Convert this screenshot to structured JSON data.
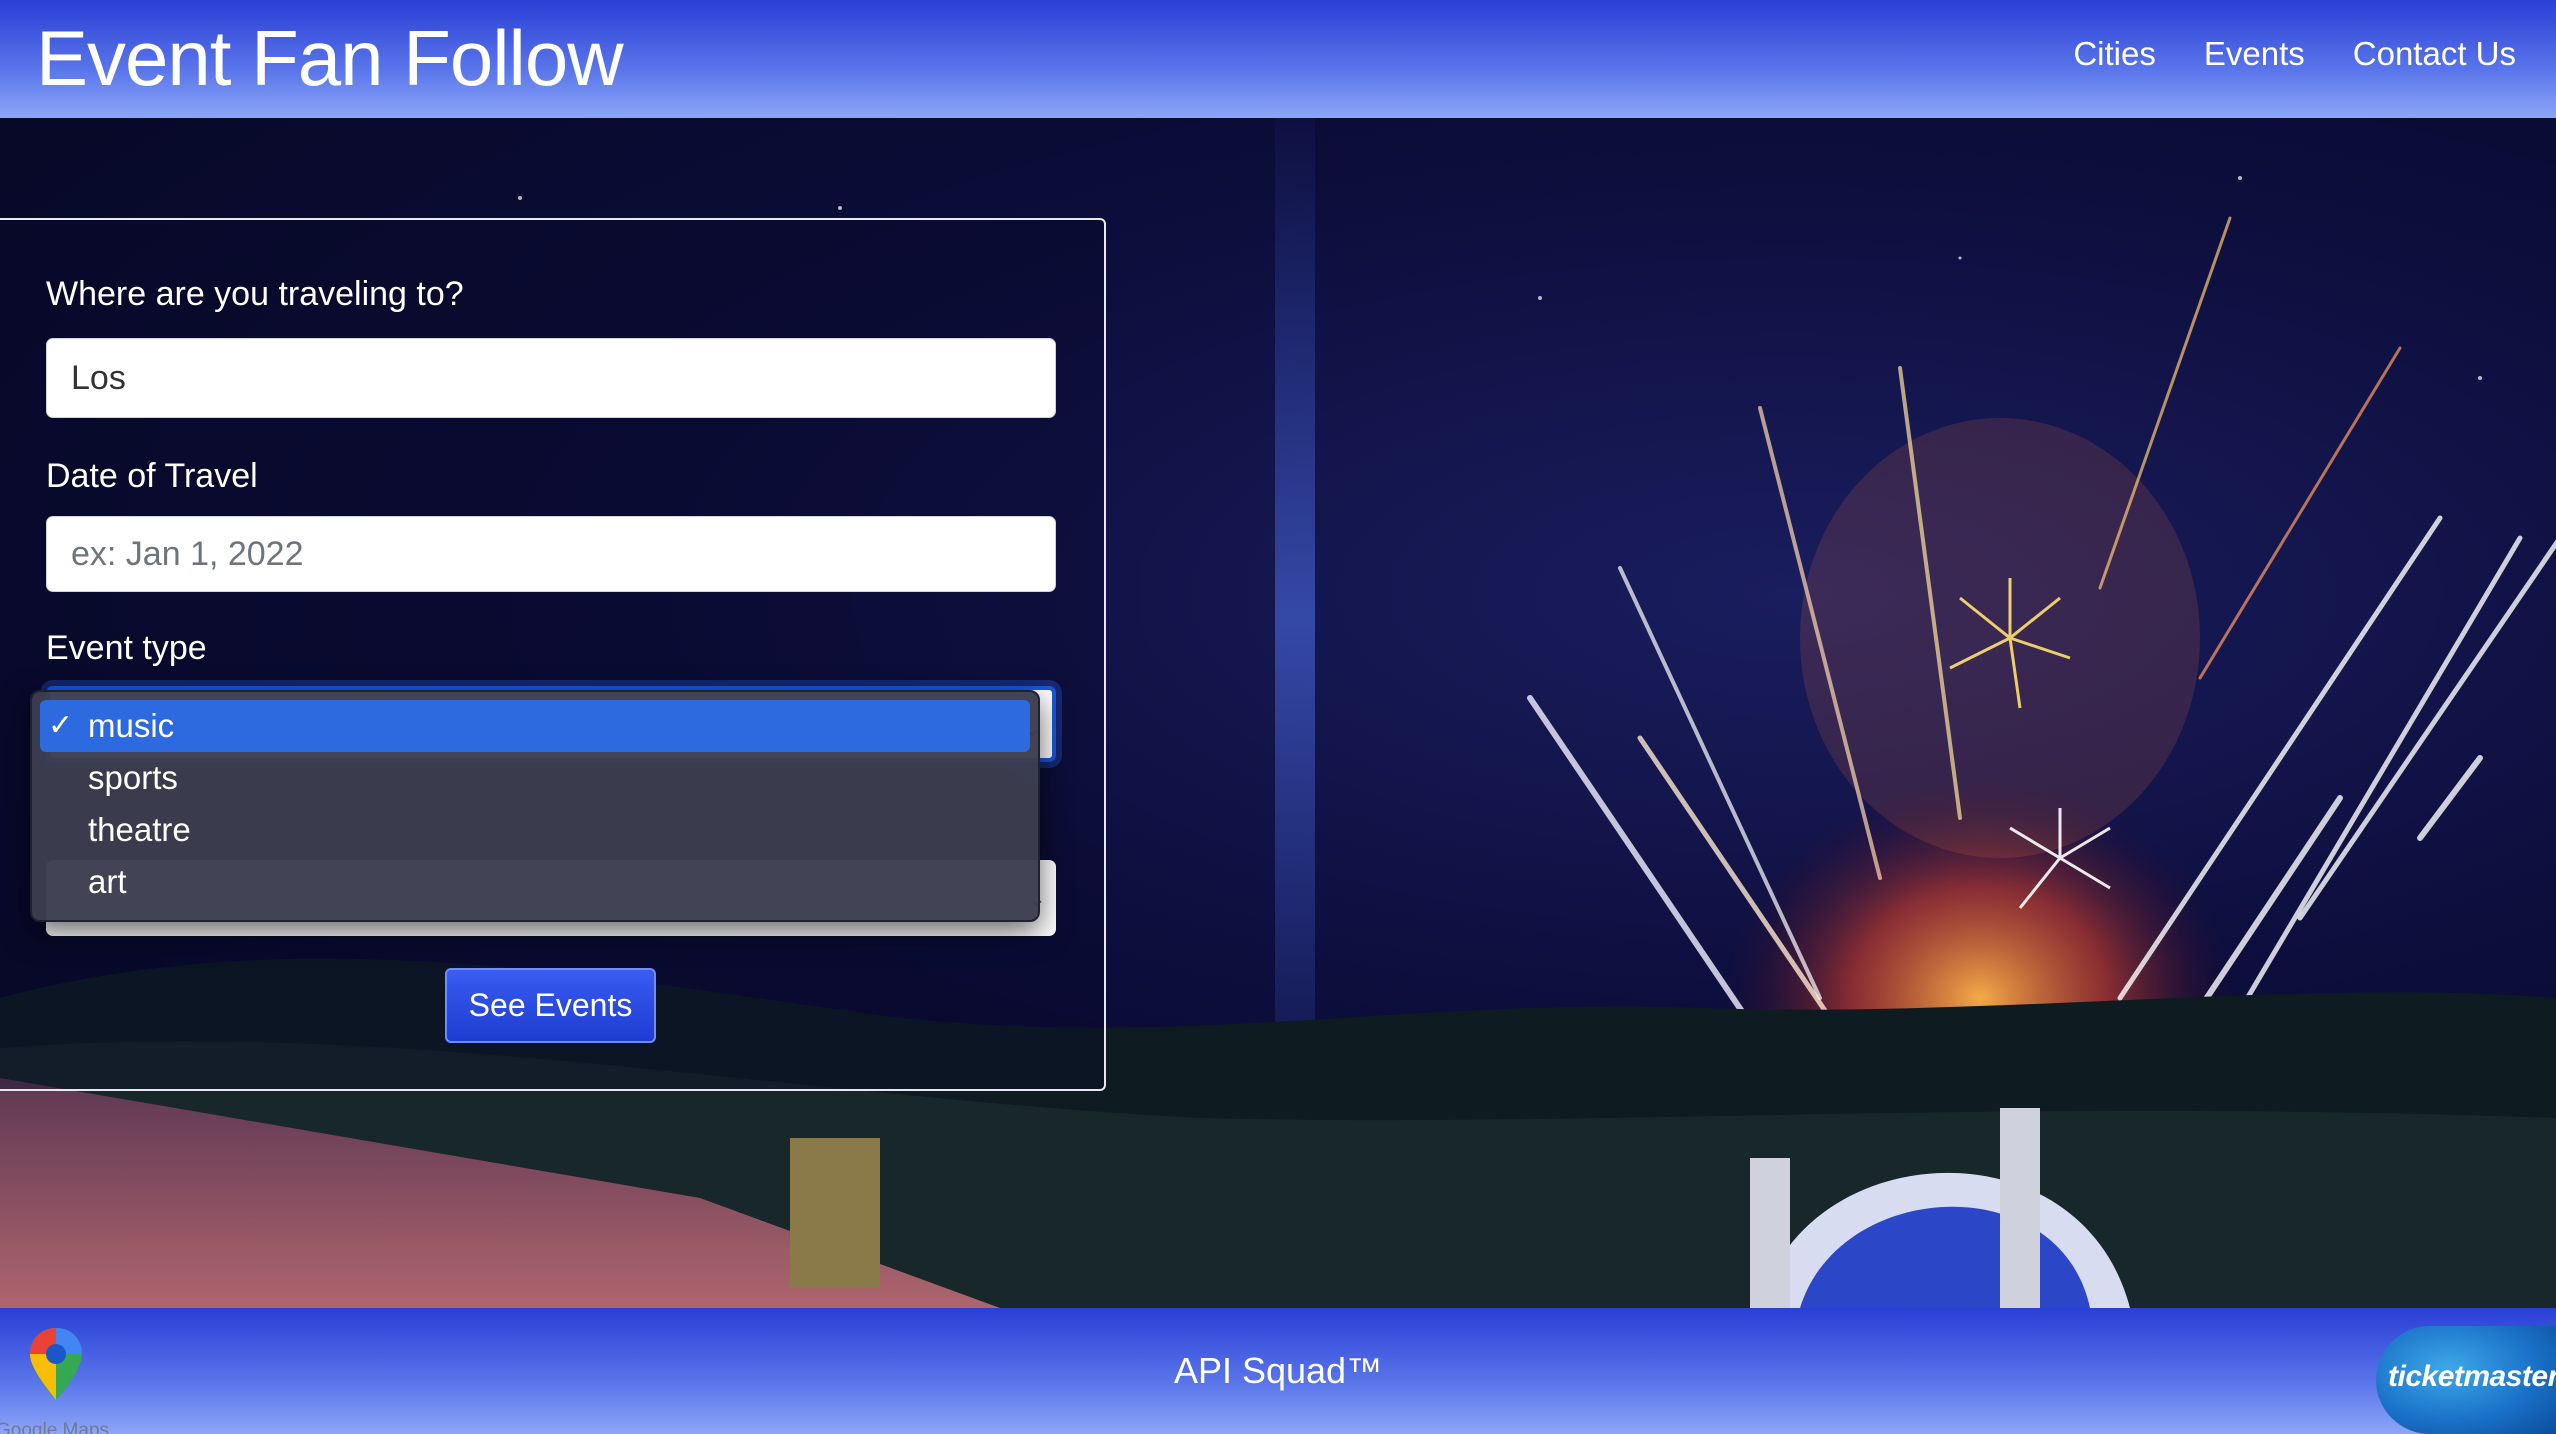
{
  "header": {
    "brand": "Event Fan Follow",
    "nav": [
      "Cities",
      "Events",
      "Contact Us"
    ]
  },
  "form": {
    "destination": {
      "label": "Where are you traveling to?",
      "value": "Los"
    },
    "date": {
      "label": "Date of Travel",
      "placeholder": "ex: Jan 1, 2022",
      "value": ""
    },
    "event_type": {
      "label": "Event type",
      "selected": "music",
      "options": [
        "music",
        "sports",
        "theatre",
        "art"
      ],
      "dropdown_open": true
    },
    "submit_label": "See Events"
  },
  "hero": {
    "background": "fireworks-concert-photo"
  },
  "footer": {
    "text": "API Squad™",
    "left_logo": {
      "icon": "google-maps-pin-icon",
      "label": "Google Maps"
    },
    "right_logo": {
      "icon": "ticketmaster-logo",
      "label": "ticketmaster"
    }
  },
  "colors": {
    "header_gradient_top": "#2a3fd6",
    "header_gradient_bottom": "#8ca6f6",
    "button": "#2a4ae0",
    "selected_option": "#2d6ae0",
    "dropdown_bg": "#3c3e50"
  }
}
